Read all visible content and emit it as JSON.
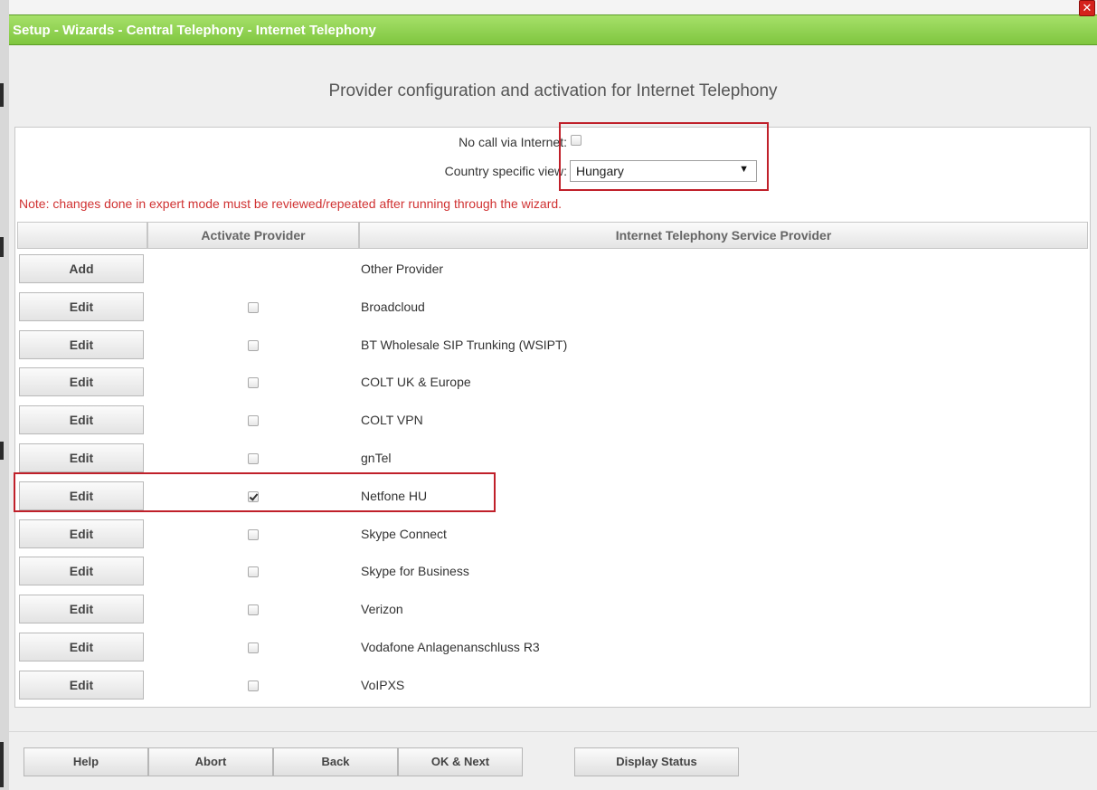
{
  "window": {
    "title": "Setup - Wizards - Central Telephony - Internet Telephony"
  },
  "page": {
    "heading": "Provider configuration and activation for Internet Telephony"
  },
  "options": {
    "no_call_label": "No call via Internet:",
    "no_call_checked": false,
    "country_label": "Country specific view:",
    "country_value": "Hungary"
  },
  "note": "Note: changes done in expert mode must be reviewed/repeated after running through the wizard.",
  "table": {
    "headers": [
      "",
      "Activate Provider",
      "Internet Telephony Service Provider"
    ],
    "rows": [
      {
        "button": "Add",
        "checkbox": false,
        "checked": false,
        "provider": "Other Provider"
      },
      {
        "button": "Edit",
        "checkbox": true,
        "checked": false,
        "provider": "Broadcloud"
      },
      {
        "button": "Edit",
        "checkbox": true,
        "checked": false,
        "provider": "BT Wholesale SIP Trunking (WSIPT)"
      },
      {
        "button": "Edit",
        "checkbox": true,
        "checked": false,
        "provider": "COLT UK & Europe"
      },
      {
        "button": "Edit",
        "checkbox": true,
        "checked": false,
        "provider": "COLT VPN"
      },
      {
        "button": "Edit",
        "checkbox": true,
        "checked": false,
        "provider": "gnTel"
      },
      {
        "button": "Edit",
        "checkbox": true,
        "checked": true,
        "provider": "Netfone HU"
      },
      {
        "button": "Edit",
        "checkbox": true,
        "checked": false,
        "provider": "Skype Connect"
      },
      {
        "button": "Edit",
        "checkbox": true,
        "checked": false,
        "provider": "Skype for Business"
      },
      {
        "button": "Edit",
        "checkbox": true,
        "checked": false,
        "provider": "Verizon"
      },
      {
        "button": "Edit",
        "checkbox": true,
        "checked": false,
        "provider": "Vodafone Anlagenanschluss R3"
      },
      {
        "button": "Edit",
        "checkbox": true,
        "checked": false,
        "provider": "VoIPXS"
      }
    ]
  },
  "footer": {
    "help": "Help",
    "abort": "Abort",
    "back": "Back",
    "ok_next": "OK & Next",
    "display_status": "Display Status"
  },
  "colors": {
    "title_bar": "#8ed04f",
    "highlight": "#c0202a",
    "note_text": "#d03232"
  }
}
